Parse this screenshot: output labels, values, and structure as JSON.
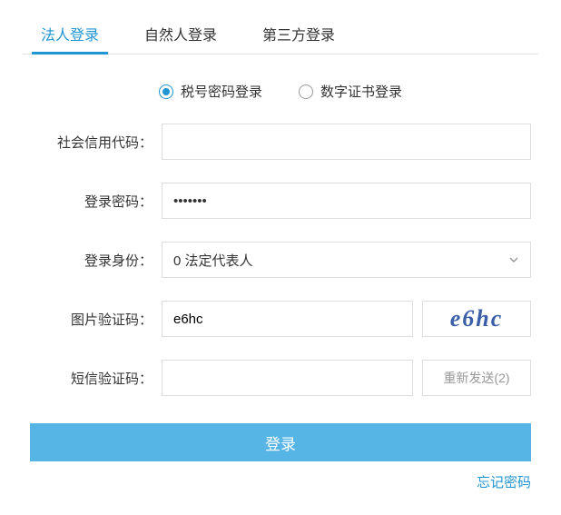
{
  "tabs": [
    {
      "label": "法人登录",
      "active": true
    },
    {
      "label": "自然人登录",
      "active": false
    },
    {
      "label": "第三方登录",
      "active": false
    }
  ],
  "login_methods": [
    {
      "label": "税号密码登录",
      "selected": true
    },
    {
      "label": "数字证书登录",
      "selected": false
    }
  ],
  "form": {
    "credit_code": {
      "label": "社会信用代码：",
      "value": ""
    },
    "password": {
      "label": "登录密码：",
      "value": "•••••••"
    },
    "identity": {
      "label": "登录身份：",
      "value": "0 法定代表人"
    },
    "image_captcha": {
      "label": "图片验证码：",
      "value": "e6hc",
      "captcha_text": "e6hc"
    },
    "sms_captcha": {
      "label": "短信验证码：",
      "value": "",
      "button_text": "重新发送(2)"
    }
  },
  "login_button": "登录",
  "forgot_password": "忘记密码"
}
